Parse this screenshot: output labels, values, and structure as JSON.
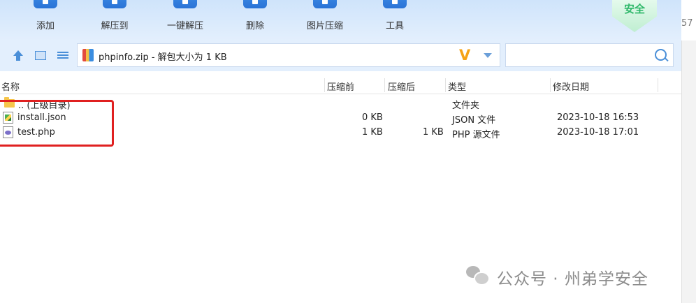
{
  "toolbar": {
    "add_label": "添加",
    "extract_to_label": "解压到",
    "one_click_extract_label": "一键解压",
    "delete_label": "删除",
    "image_compress_label": "图片压缩",
    "tools_label": "工具",
    "safe_badge": "安全",
    "edge_number": "57"
  },
  "address": {
    "path_text": "phpinfo.zip - 解包大小为 1 KB",
    "logo_glyph": "V"
  },
  "search": {
    "placeholder": ""
  },
  "columns": {
    "name": "名称",
    "size_before": "压缩前",
    "size_after": "压缩后",
    "type": "类型",
    "modified": "修改日期"
  },
  "rows": [
    {
      "name": ".. (上级目录)",
      "size_before": "",
      "size_after": "",
      "type": "文件夹",
      "modified": ""
    },
    {
      "name": "install.json",
      "size_before": "0 KB",
      "size_after": "",
      "type": "JSON 文件",
      "modified": "2023-10-18 16:53"
    },
    {
      "name": "test.php",
      "size_before": "1 KB",
      "size_after": "1 KB",
      "type": "PHP 源文件",
      "modified": "2023-10-18 17:01"
    }
  ],
  "watermark": {
    "text": "公众号 · 州弟学安全"
  },
  "colors": {
    "toolbar_bg": "#cfe4fb",
    "highlight_box": "#e02020",
    "accent": "#2a73d6"
  }
}
